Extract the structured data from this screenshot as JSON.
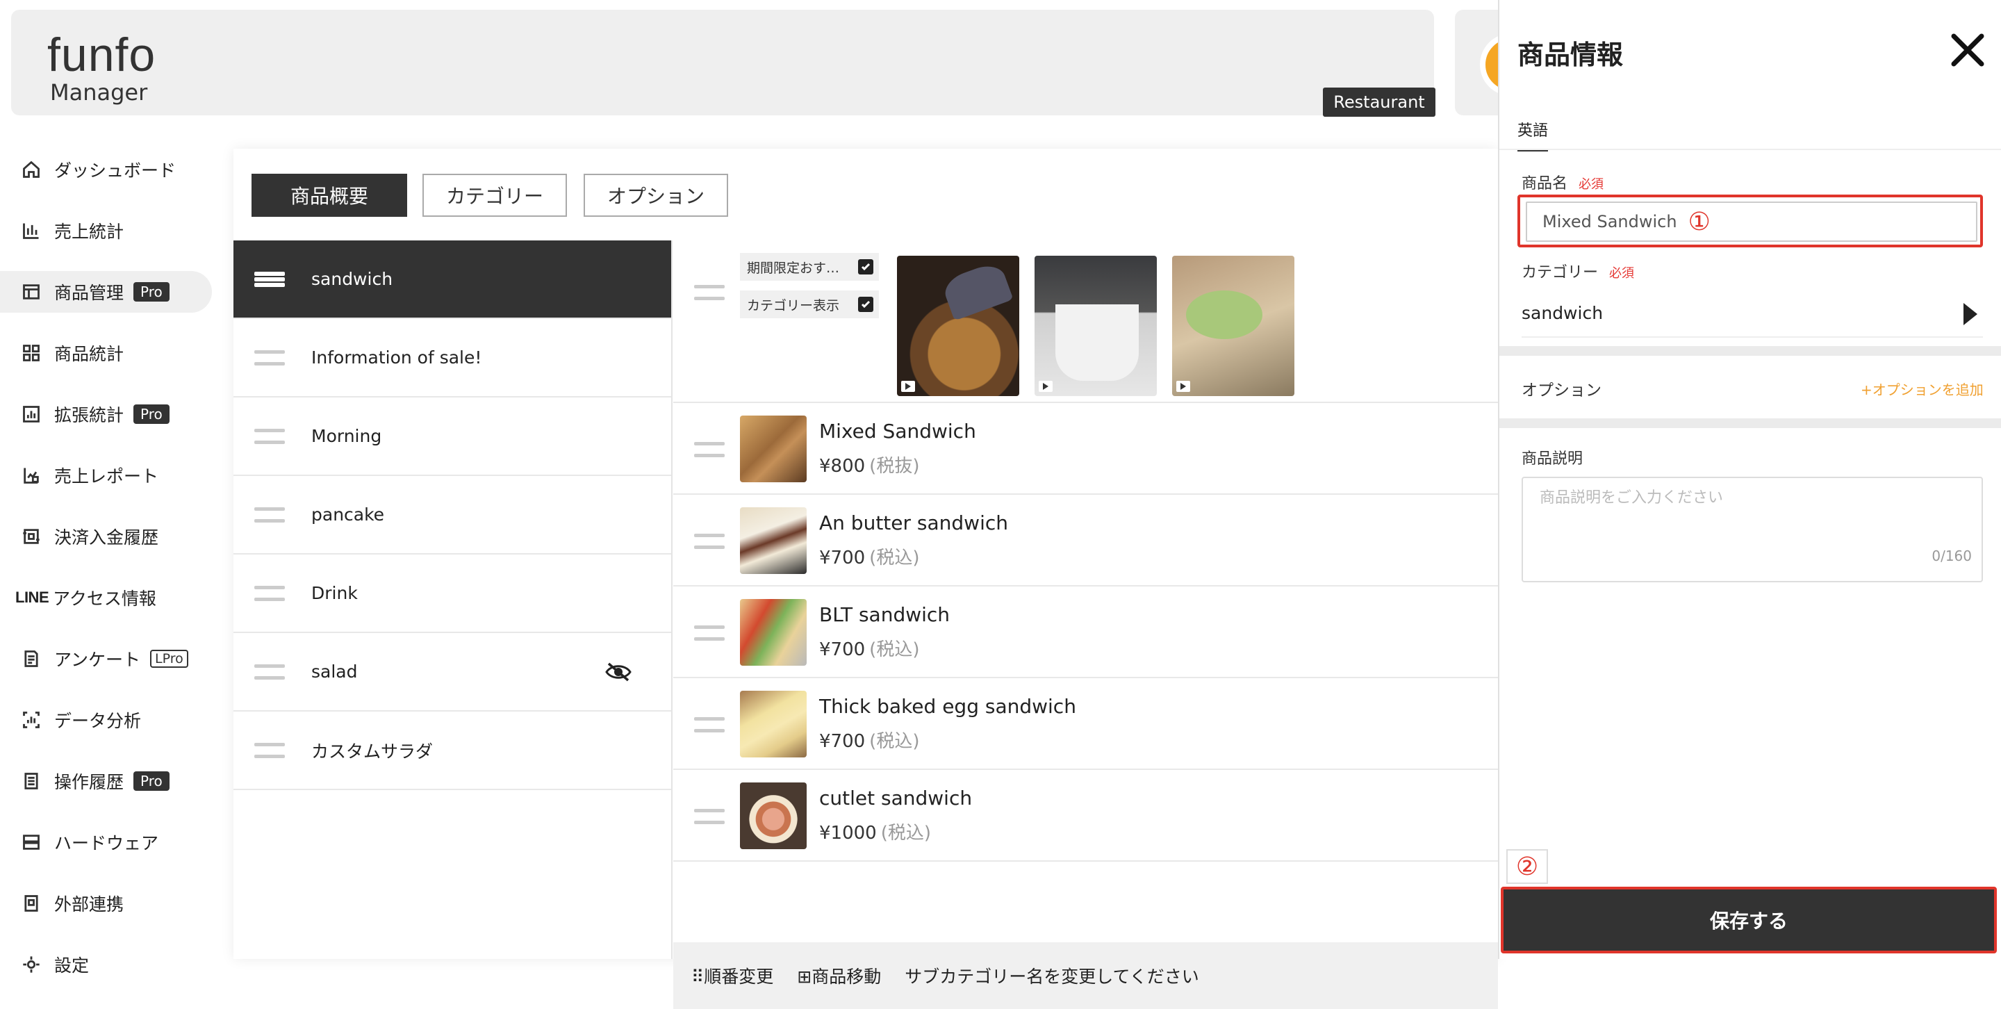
{
  "header": {
    "logo_main": "funfo",
    "logo_sub": "Manager",
    "badge": "Restaurant"
  },
  "sidebar": {
    "items": [
      {
        "label": "ダッシュボード",
        "icon": "home-icon"
      },
      {
        "label": "売上統計",
        "icon": "bar-chart-icon"
      },
      {
        "label": "商品管理",
        "icon": "layout-icon",
        "badge": "Pro",
        "active": true
      },
      {
        "label": "商品統計",
        "icon": "grid-icon"
      },
      {
        "label": "拡張統計",
        "icon": "chart-box-icon",
        "badge": "Pro"
      },
      {
        "label": "売上レポート",
        "icon": "report-icon"
      },
      {
        "label": "決済入金履歴",
        "icon": "payment-history-icon"
      },
      {
        "label": "アクセス情報",
        "icon": "line-icon",
        "prefix": "LINE"
      },
      {
        "label": "アンケート",
        "icon": "survey-icon",
        "badge": "LPro"
      },
      {
        "label": "データ分析",
        "icon": "analysis-icon"
      },
      {
        "label": "操作履歴",
        "icon": "log-icon",
        "badge": "Pro"
      },
      {
        "label": "ハードウェア",
        "icon": "hardware-icon"
      },
      {
        "label": "外部連携",
        "icon": "integration-icon"
      },
      {
        "label": "設定",
        "icon": "settings-icon"
      }
    ]
  },
  "tabs": [
    {
      "label": "商品概要",
      "active": true
    },
    {
      "label": "カテゴリー"
    },
    {
      "label": "オプション"
    }
  ],
  "categories": [
    {
      "label": "sandwich",
      "active": true
    },
    {
      "label": "Information of sale!"
    },
    {
      "label": "Morning"
    },
    {
      "label": "pancake"
    },
    {
      "label": "Drink"
    },
    {
      "label": "salad",
      "hidden": true
    },
    {
      "label": "カスタムサラダ"
    }
  ],
  "category_settings": {
    "recommend_label": "期間限定おす…",
    "show_category_label": "カテゴリー表示"
  },
  "products": [
    {
      "name": "Mixed Sandwich",
      "price": "¥800",
      "tax": "(税抜)"
    },
    {
      "name": "An butter sandwich",
      "price": "¥700",
      "tax": "(税込)"
    },
    {
      "name": "BLT sandwich",
      "price": "¥700",
      "tax": "(税込)"
    },
    {
      "name": "Thick baked egg sandwich",
      "price": "¥700",
      "tax": "(税込)"
    },
    {
      "name": "cutlet sandwich",
      "price": "¥1000",
      "tax": "(税込)"
    }
  ],
  "bottom_bar": {
    "reorder": "⠿順番変更",
    "move": "⊞商品移動",
    "rename": "サブカテゴリー名を変更してください"
  },
  "drawer": {
    "title": "商品情報",
    "lang_tab": "英語",
    "name_label": "商品名",
    "required": "必須",
    "name_value": "Mixed Sandwich",
    "marker1": "①",
    "category_label": "カテゴリー",
    "category_value": "sandwich",
    "option_label": "オプション",
    "option_add": "+オプションを追加",
    "desc_label": "商品説明",
    "desc_placeholder": "商品説明をご入力ください",
    "desc_count": "0/160",
    "marker2": "②",
    "save": "保存する"
  },
  "colors": {
    "dark": "#333333",
    "accent_red": "#e0352b",
    "option_orange": "#f0a030"
  }
}
